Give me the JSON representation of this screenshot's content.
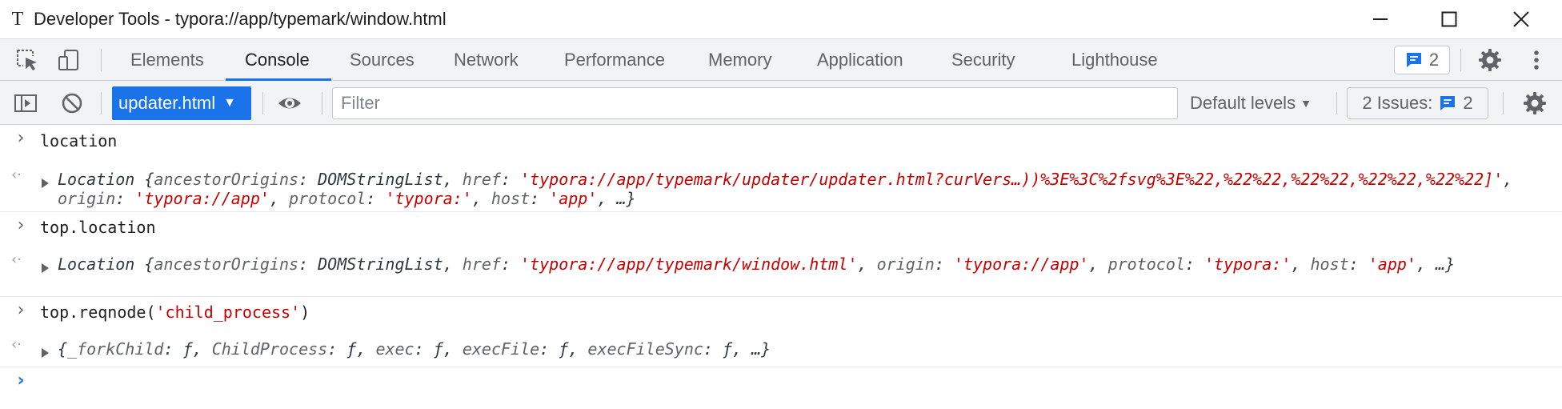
{
  "window": {
    "app_icon_glyph": "T",
    "title": "Developer Tools - typora://app/typemark/window.html",
    "controls": [
      "minimize-icon",
      "maximize-icon",
      "close-icon"
    ]
  },
  "tabbar": {
    "left_icons": [
      "inspect-element-icon",
      "device-toolbar-icon"
    ],
    "tabs": [
      {
        "label": "Elements",
        "active": false
      },
      {
        "label": "Console",
        "active": true
      },
      {
        "label": "Sources",
        "active": false
      },
      {
        "label": "Network",
        "active": false
      },
      {
        "label": "Performance",
        "active": false
      },
      {
        "label": "Memory",
        "active": false
      },
      {
        "label": "Application",
        "active": false
      },
      {
        "label": "Security",
        "active": false
      },
      {
        "label": "Lighthouse",
        "active": false
      }
    ],
    "messages_count": "2",
    "right_icons": [
      "settings-gear-icon",
      "more-options-icon"
    ]
  },
  "toolbar": {
    "icons": [
      "sidebar-toggle-icon",
      "clear-console-icon",
      "live-expression-eye-icon",
      "console-settings-gear-icon"
    ],
    "context": "updater.html",
    "filter_placeholder": "Filter",
    "levels": "Default levels",
    "issues_label": "2 Issues:",
    "issues_count": "2"
  },
  "console": {
    "entries": [
      {
        "input": "location",
        "result": {
          "type_name": "Location",
          "line1_parts": [
            "{",
            "ancestorOrigins",
            ": ",
            "DOMStringList",
            ", ",
            "href",
            ": ",
            "'typora://app/typemark/updater/updater.html?curVers…))%3E%3C%2fsvg%3E%22,%22%22,%22%22,%2",
            ""
          ],
          "line2_parts": [
            "2%22,%22%22]'",
            ", ",
            "origin",
            ": ",
            "'typora://app'",
            ", ",
            "protocol",
            ": ",
            "'typora:'",
            ", ",
            "host",
            ": ",
            "'app'",
            ", …}"
          ]
        }
      },
      {
        "input": "top.location",
        "result": {
          "type_name": "Location",
          "line1_parts": [
            "{",
            "ancestorOrigins",
            ": ",
            "DOMStringList",
            ", ",
            "href",
            ": ",
            "'typora://app/typemark/window.html'",
            ", ",
            "origin",
            ": ",
            "'typora://app'",
            ", ",
            "protocol",
            ": ",
            "'typora:'",
            ", ",
            "host",
            ": ",
            "'a"
          ],
          "line2_parts": [
            "pp'",
            ", …}"
          ]
        }
      },
      {
        "input_prefix": "top.reqnode(",
        "input_string": "'child_process'",
        "input_suffix": ")",
        "result": {
          "line1_parts": [
            "{",
            "_forkChild",
            ": ",
            "ƒ",
            ", ",
            "ChildProcess",
            ": ",
            "ƒ",
            ", ",
            "exec",
            ": ",
            "ƒ",
            ", ",
            "execFile",
            ": ",
            "ƒ",
            ", ",
            "execFileSync",
            ": ",
            "ƒ",
            ", …}"
          ]
        }
      }
    ],
    "prompt_glyph": "›",
    "result_glyph": "‹·"
  },
  "colors": {
    "accent": "#1a73e8",
    "string": "#c80000",
    "toolbar_bg": "#f1f3f4"
  }
}
